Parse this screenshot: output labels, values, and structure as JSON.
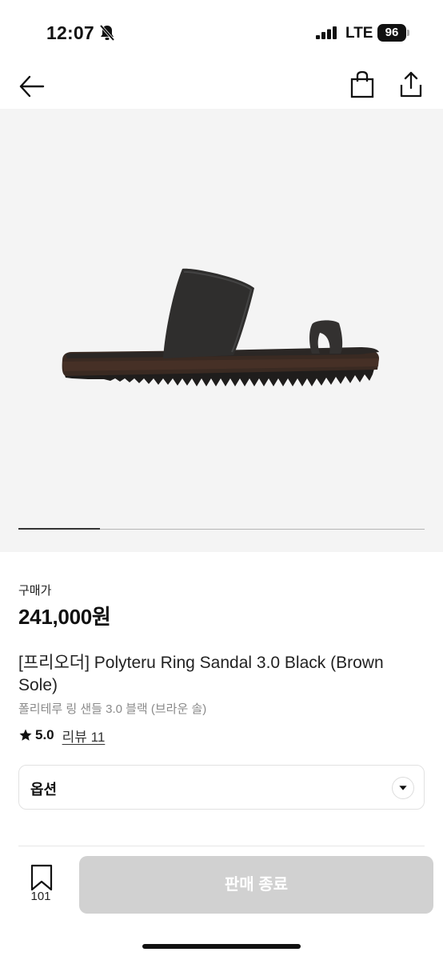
{
  "status_bar": {
    "time": "12:07",
    "network": "LTE",
    "battery": "96"
  },
  "product": {
    "price_label": "구매가",
    "price": "241,000원",
    "title": "[프리오더] Polyteru Ring Sandal 3.0 Black (Brown Sole)",
    "subtitle": "폴리테루 링 샌들 3.0 블랙 (브라운 솔)",
    "rating": "5.0",
    "review_link": "리뷰 11",
    "image_progress": 0.2
  },
  "option": {
    "label": "옵션"
  },
  "bottom_bar": {
    "bookmark_count": "101",
    "action_label": "판매 종료"
  },
  "icons": {
    "back": "arrow-left-icon",
    "bag": "shopping-bag-icon",
    "share": "share-icon",
    "bookmark": "bookmark-icon",
    "star": "star-icon",
    "option_arrow": "chevron-down-icon",
    "mute": "bell-slash-icon"
  },
  "colors": {
    "sold_out_bg": "#d1d1d1",
    "image_bg": "#f4f4f4"
  }
}
